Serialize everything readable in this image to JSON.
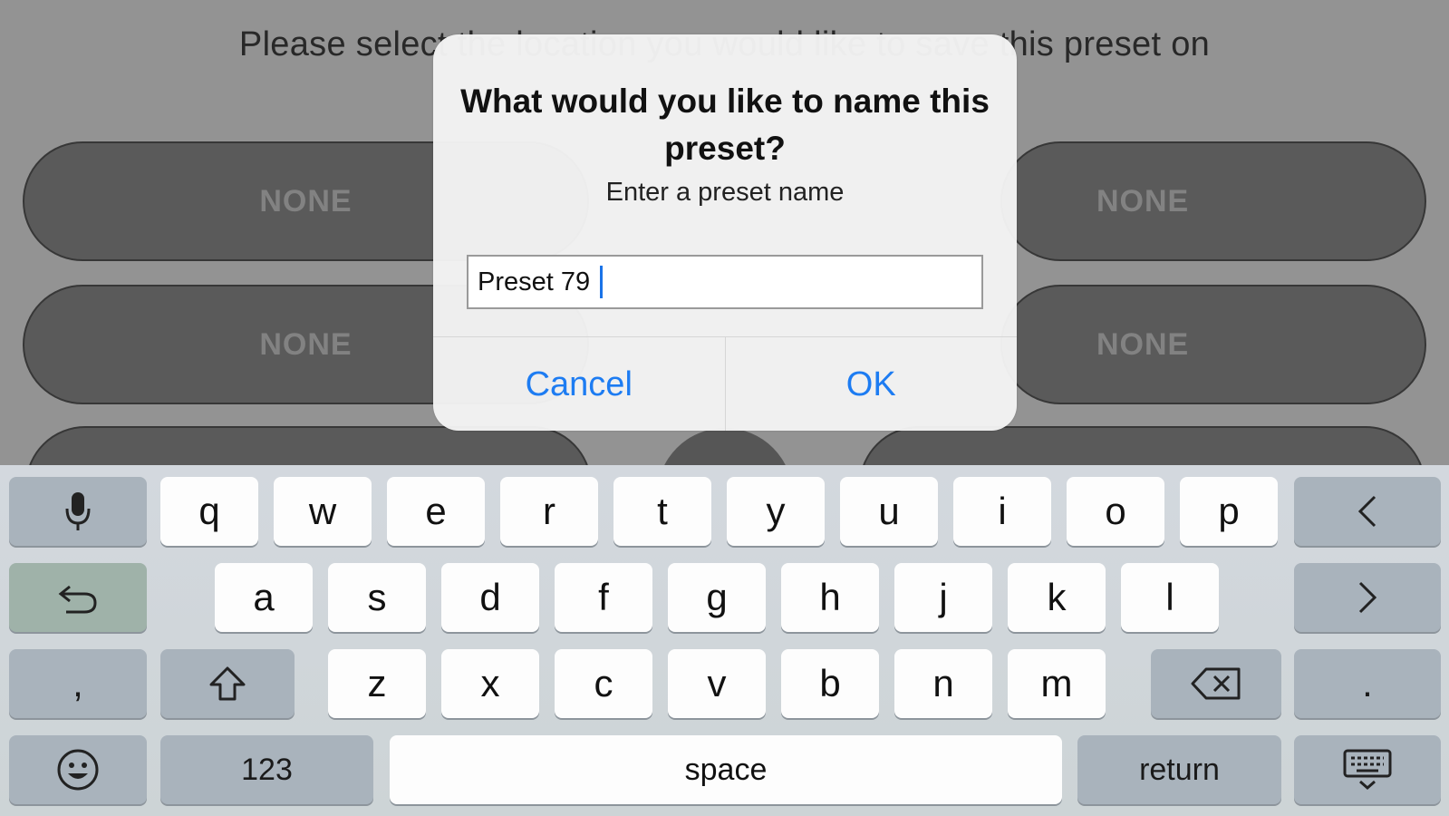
{
  "background": {
    "title": "Please select the location you would like to save this preset on",
    "slot_label": "NONE"
  },
  "alert": {
    "title": "What would you like to name this preset?",
    "message": "Enter a preset name",
    "input_value": "Preset 79",
    "cancel_label": "Cancel",
    "ok_label": "OK"
  },
  "keyboard": {
    "row1": [
      "q",
      "w",
      "e",
      "r",
      "t",
      "y",
      "u",
      "i",
      "o",
      "p"
    ],
    "row2": [
      "a",
      "s",
      "d",
      "f",
      "g",
      "h",
      "j",
      "k",
      "l"
    ],
    "row3": [
      "z",
      "x",
      "c",
      "v",
      "b",
      "n",
      "m"
    ],
    "comma": ",",
    "period": ".",
    "numbers_label": "123",
    "space_label": "space",
    "return_label": "return",
    "icons": [
      "microphone-icon",
      "undo-icon",
      "shift-icon",
      "backspace-icon",
      "emoji-icon",
      "chevron-left-icon",
      "chevron-right-icon",
      "keyboard-dismiss-icon"
    ]
  },
  "colors": {
    "accent": "#1d7cf2",
    "slot": "#5f5f5f",
    "dim_bg": "#9b9b9b"
  }
}
